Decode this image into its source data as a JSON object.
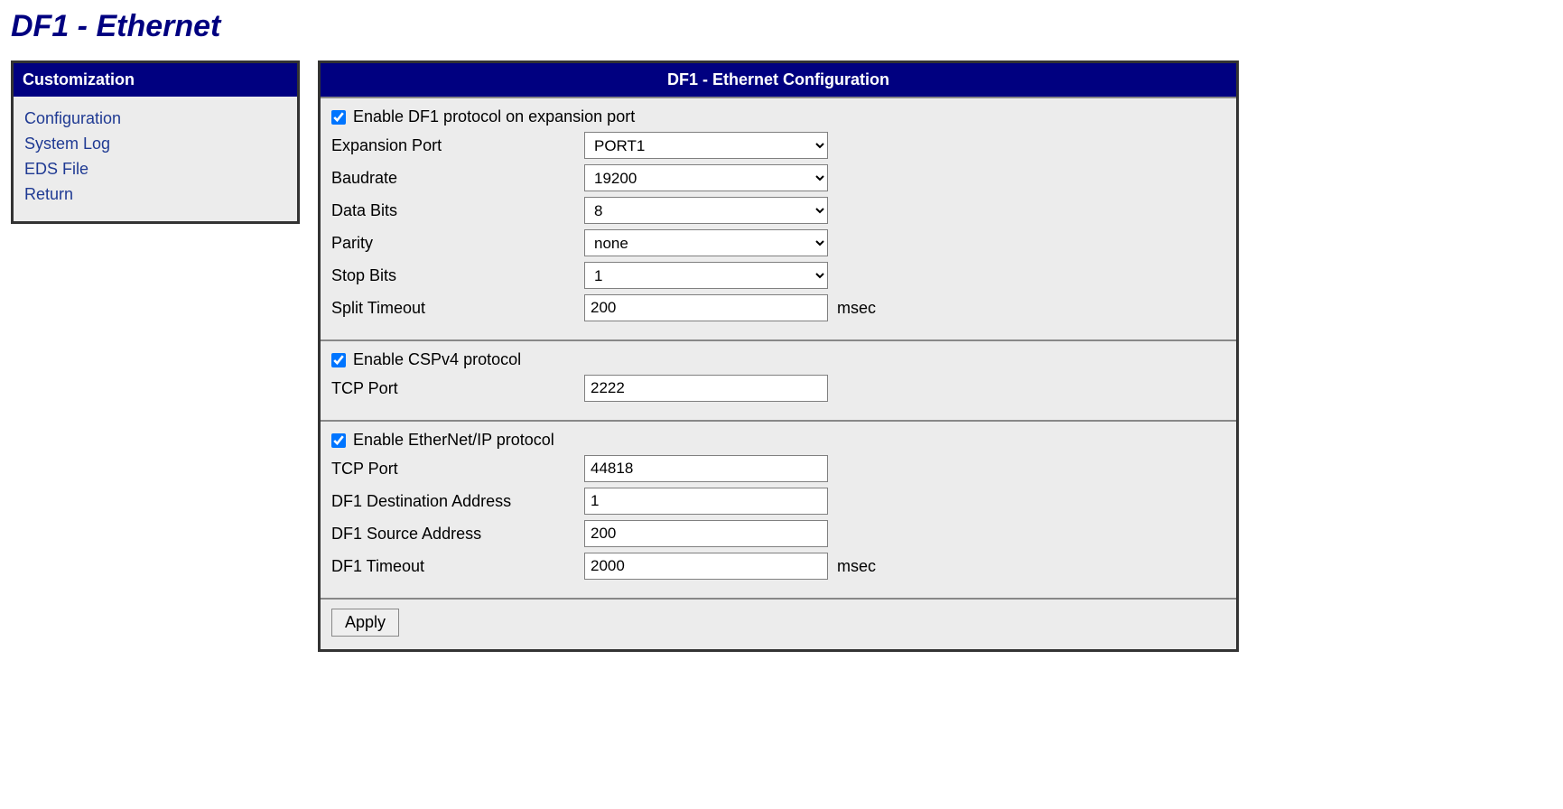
{
  "page": {
    "title": "DF1 - Ethernet"
  },
  "sidebar": {
    "header": "Customization",
    "items": [
      {
        "label": "Configuration"
      },
      {
        "label": "System Log"
      },
      {
        "label": "EDS File"
      },
      {
        "label": "Return"
      }
    ]
  },
  "main": {
    "header": "DF1 - Ethernet Configuration",
    "section_df1": {
      "enable_label": "Enable DF1 protocol on expansion port",
      "enable_checked": true,
      "expansion_port": {
        "label": "Expansion Port",
        "value": "PORT1"
      },
      "baudrate": {
        "label": "Baudrate",
        "value": "19200"
      },
      "data_bits": {
        "label": "Data Bits",
        "value": "8"
      },
      "parity": {
        "label": "Parity",
        "value": "none"
      },
      "stop_bits": {
        "label": "Stop Bits",
        "value": "1"
      },
      "split_timeout": {
        "label": "Split Timeout",
        "value": "200",
        "unit": "msec"
      }
    },
    "section_cspv4": {
      "enable_label": "Enable CSPv4 protocol",
      "enable_checked": true,
      "tcp_port": {
        "label": "TCP Port",
        "value": "2222"
      }
    },
    "section_enip": {
      "enable_label": "Enable EtherNet/IP protocol",
      "enable_checked": true,
      "tcp_port": {
        "label": "TCP Port",
        "value": "44818"
      },
      "df1_dest": {
        "label": "DF1 Destination Address",
        "value": "1"
      },
      "df1_src": {
        "label": "DF1 Source Address",
        "value": "200"
      },
      "df1_timeout": {
        "label": "DF1 Timeout",
        "value": "2000",
        "unit": "msec"
      }
    },
    "apply_label": "Apply"
  }
}
